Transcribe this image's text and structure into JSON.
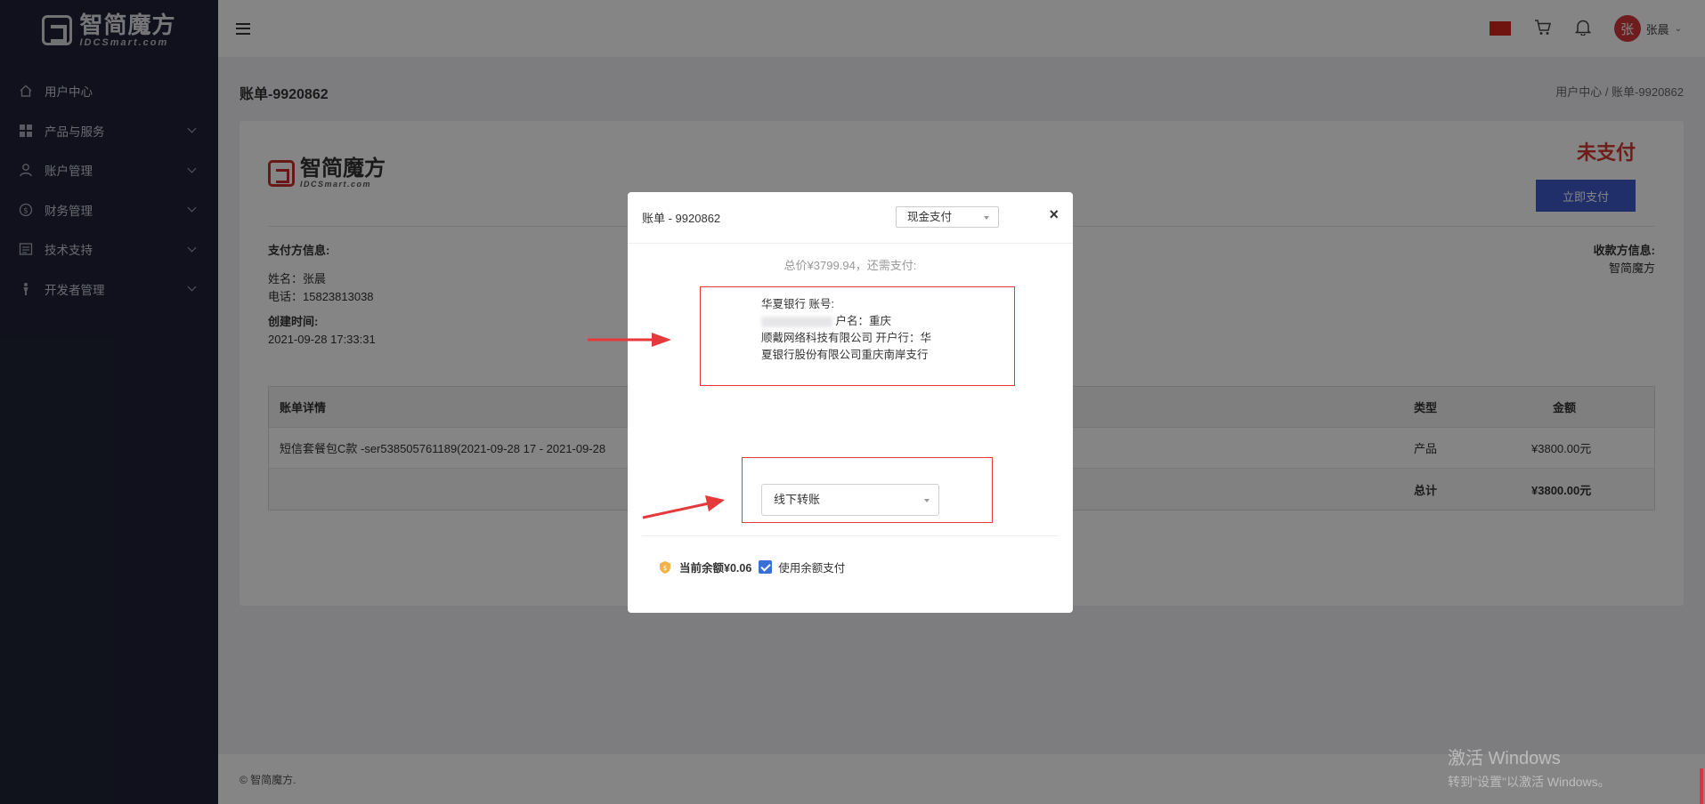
{
  "sidebar": {
    "logo_cn": "智简魔方",
    "logo_en": "IDCSmart.com",
    "items": [
      {
        "label": "用户中心",
        "icon": "home-icon",
        "has_submenu": false
      },
      {
        "label": "产品与服务",
        "icon": "grid-icon",
        "has_submenu": true
      },
      {
        "label": "账户管理",
        "icon": "user-icon",
        "has_submenu": true
      },
      {
        "label": "财务管理",
        "icon": "dollar-icon",
        "has_submenu": true
      },
      {
        "label": "技术支持",
        "icon": "ticket-icon",
        "has_submenu": true
      },
      {
        "label": "开发者管理",
        "icon": "developer-icon",
        "has_submenu": true
      }
    ]
  },
  "topbar": {
    "user_avatar": "张",
    "user_name": "张晨",
    "flag_color": "#d52a1e"
  },
  "page": {
    "title": "账单-9920862",
    "breadcrumb": "用户中心  /  账单-9920862"
  },
  "invoice": {
    "logo_cn": "智简魔方",
    "logo_en": "IDCSmart.com",
    "status": "未支付",
    "pay_now_label": "立即支付",
    "payer_title": "支付方信息:",
    "payer_name": "姓名：张晨",
    "payer_phone": "电话：15823813038",
    "created_title": "创建时间:",
    "created_at": "2021-09-28 17:33:31",
    "payee_title": "收款方信息:",
    "payee_name": "智简魔方",
    "table": {
      "headers": [
        "账单详情",
        "类型",
        "金额"
      ],
      "rows": [
        [
          "短信套餐包C款 -ser538505761189(2021-09-28 17 - 2021-09-28",
          "产品",
          "¥3800.00元"
        ]
      ],
      "total_label": "总计",
      "total_value": "¥3800.00元"
    }
  },
  "footer": {
    "text": "© 智简魔方."
  },
  "modal": {
    "title": "账单 - 9920862",
    "method": "现金支付",
    "total_due": "总价¥3799.94，还需支付:",
    "bank_line1": "华夏银行 账号:",
    "bank_line2": "户名：重庆",
    "bank_line3": "顺戴网络科技有限公司 开户行：华",
    "bank_line4": "夏银行股份有限公司重庆南岸支行",
    "transfer_option": "线下转账",
    "balance_text": "当前余额¥0.06",
    "use_balance_label": "使用余额支付",
    "use_balance_checked": true
  },
  "watermark": {
    "line1": "激活 Windows",
    "line2": "转到\"设置\"以激活 Windows。"
  },
  "colors": {
    "sidebar_bg": "#1f2236",
    "accent": "#3e58c9",
    "unpaid_red": "#d13b33",
    "annotation_red": "#e5393b"
  }
}
